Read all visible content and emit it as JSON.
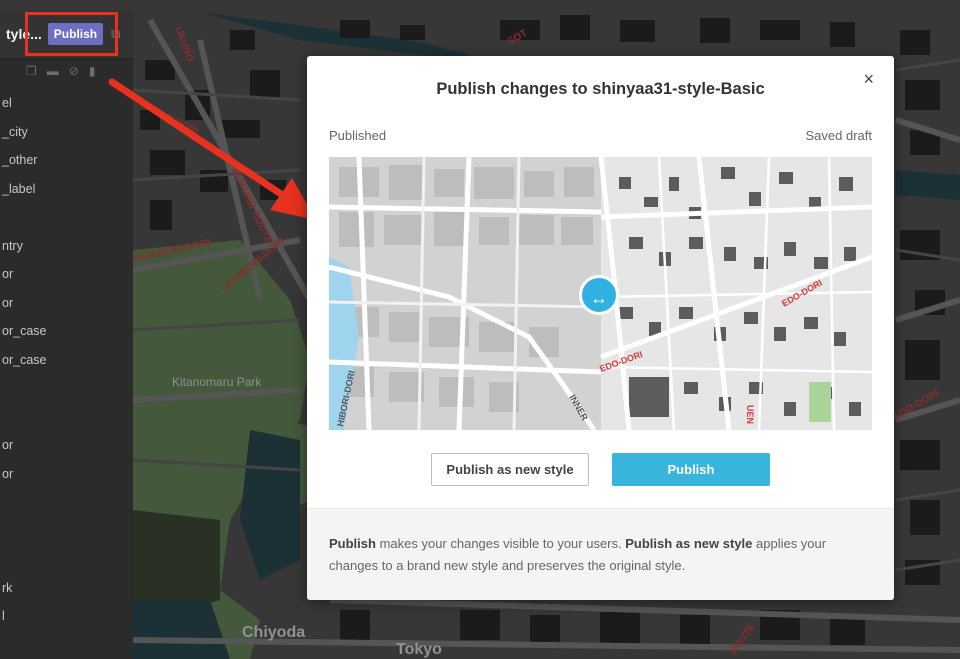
{
  "sidebar": {
    "style_title": "tyle...",
    "publish_label": "Publish",
    "layers": [
      "el",
      "_city",
      "_other",
      "_label",
      "",
      "ntry",
      "or",
      "or",
      "or_case",
      "or_case",
      "",
      "",
      "or",
      "or",
      "",
      "",
      "",
      "rk",
      "l"
    ]
  },
  "map_labels": {
    "kitanomaru": "Kitanomaru Park",
    "chiyoda": "Chiyoda",
    "tokyo": "Tokyo",
    "yasukuni": "YASUKUNI-DORI",
    "uchibori": "UCHIBORI-DORI",
    "bukuro_top": "KURO ROUTE",
    "bukuro": "BUKURO ROUTE",
    "ukuro": "UKURO",
    "route": "ROUTE",
    "edo": "EDO-DORI",
    "sot": "SOT",
    "lro": "IRO-DORI"
  },
  "modal": {
    "title": "Publish changes to shinyaa31-style-Basic",
    "close_glyph": "×",
    "left_label": "Published",
    "right_label": "Saved draft",
    "swipe_glyph": "↔",
    "compare_labels": {
      "edo_top": "EDO-DORI",
      "edo_mid": "EDO-DORI",
      "hibori": "HIBORI-DORI",
      "inner": "INNER",
      "ueno": "UEN"
    },
    "btn_new_style": "Publish as new style",
    "btn_publish": "Publish",
    "footer": {
      "p1_bold": "Publish",
      "p1_text": " makes your changes visible to your users. ",
      "p2_bold": "Publish as new style",
      "p2_text": " applies your changes to a brand new style and preserves the original style."
    }
  },
  "colors": {
    "accent": "#39b4dd",
    "sidebar_publish": "#6e6fc2",
    "callout": "#e8311e"
  }
}
